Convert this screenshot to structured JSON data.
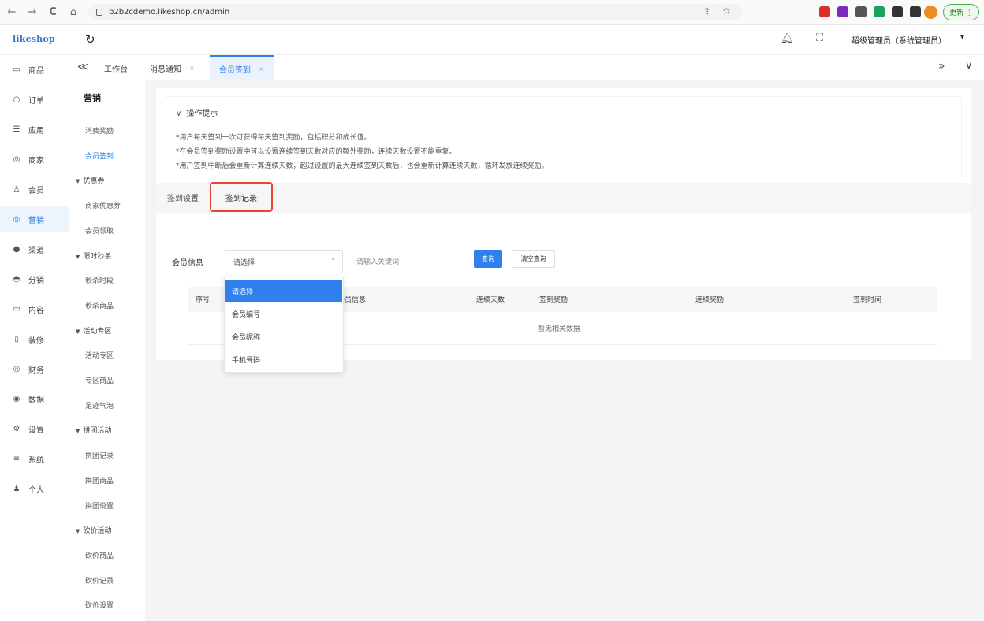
{
  "browser": {
    "back": "←",
    "forward": "→",
    "reload": "C",
    "home": "⌂",
    "url": "b2b2cdemo.likeshop.cn/admin",
    "update_label": "更新 ⋮",
    "extension_colors": [
      "#d93025",
      "#7b2cbf",
      "#555555",
      "#1aa260",
      "#333333",
      "#333333"
    ]
  },
  "header": {
    "logo": "likeshop",
    "admin": "超级管理员（系统管理员）",
    "caret": "▾"
  },
  "nav": {
    "items": [
      {
        "icon": "▭",
        "label": "商品"
      },
      {
        "icon": "○",
        "label": "订单"
      },
      {
        "icon": "☰",
        "label": "应用"
      },
      {
        "icon": "◎",
        "label": "商家"
      },
      {
        "icon": "♙",
        "label": "会员"
      },
      {
        "icon": "◎",
        "label": "营销",
        "active": true
      },
      {
        "icon": "●",
        "label": "渠道"
      },
      {
        "icon": "◓",
        "label": "分销"
      },
      {
        "icon": "▭",
        "label": "内容"
      },
      {
        "icon": "▯",
        "label": "装修"
      },
      {
        "icon": "◎",
        "label": "财务"
      },
      {
        "icon": "◉",
        "label": "数据"
      },
      {
        "icon": "⚙",
        "label": "设置"
      },
      {
        "icon": "≡",
        "label": "系统"
      },
      {
        "icon": "♟",
        "label": "个人"
      }
    ]
  },
  "tabs": {
    "collapse": "≪",
    "items": [
      {
        "label": "工作台"
      },
      {
        "label": "消息通知",
        "close": "×"
      },
      {
        "label": "会员签到",
        "close": "×",
        "active": true
      }
    ],
    "next": "»",
    "more": "∨"
  },
  "submenu": {
    "title": "营销",
    "entries": [
      {
        "type": "item",
        "label": "消费奖励"
      },
      {
        "type": "item",
        "label": "会员签到",
        "active": true
      },
      {
        "type": "group",
        "label": "优惠券"
      },
      {
        "type": "item",
        "label": "商家优惠券"
      },
      {
        "type": "item",
        "label": "会员领取"
      },
      {
        "type": "group",
        "label": "限时秒杀"
      },
      {
        "type": "item",
        "label": "秒杀时段"
      },
      {
        "type": "item",
        "label": "秒杀商品"
      },
      {
        "type": "group",
        "label": "活动专区"
      },
      {
        "type": "item",
        "label": "活动专区"
      },
      {
        "type": "item",
        "label": "专区商品"
      },
      {
        "type": "item",
        "label": "足迹气泡"
      },
      {
        "type": "group",
        "label": "拼团活动"
      },
      {
        "type": "item",
        "label": "拼团记录"
      },
      {
        "type": "item",
        "label": "拼团商品"
      },
      {
        "type": "item",
        "label": "拼团设置"
      },
      {
        "type": "group",
        "label": "砍价活动"
      },
      {
        "type": "item",
        "label": "砍价商品"
      },
      {
        "type": "item",
        "label": "砍价记录"
      },
      {
        "type": "item",
        "label": "砍价设置"
      }
    ]
  },
  "tips": {
    "title": "操作提示",
    "lines": [
      "*用户每天签到一次可获得每天签到奖励，包括积分和成长值。",
      "*在会员签到奖励设置中可以设置连续签到天数对应的额外奖励，连续天数设置不能重复。",
      "*用户签到中断后会重新计算连续天数，超过设置的最大连续签到天数后，也会重新计算连续天数，循环发放连续奖励。"
    ]
  },
  "sign_tabs": [
    "签到设置",
    "签到记录"
  ],
  "filter": {
    "label": "会员信息",
    "select_placeholder": "请选择",
    "select_arrow": "⌃",
    "keyword_placeholder": "请输入关键词",
    "query": "查询",
    "reset": "清空查询"
  },
  "table": {
    "columns": [
      "序号",
      "会员信息",
      "连续天数",
      "签到奖励",
      "连续奖励",
      "签到时间"
    ],
    "empty": "暂无相关数据"
  },
  "dropdown": {
    "options": [
      "请选择",
      "会员编号",
      "会员昵称",
      "手机号码"
    ],
    "selected_index": 0
  },
  "colors": {
    "primary": "#2f80ed",
    "highlight": "#e8472f"
  }
}
